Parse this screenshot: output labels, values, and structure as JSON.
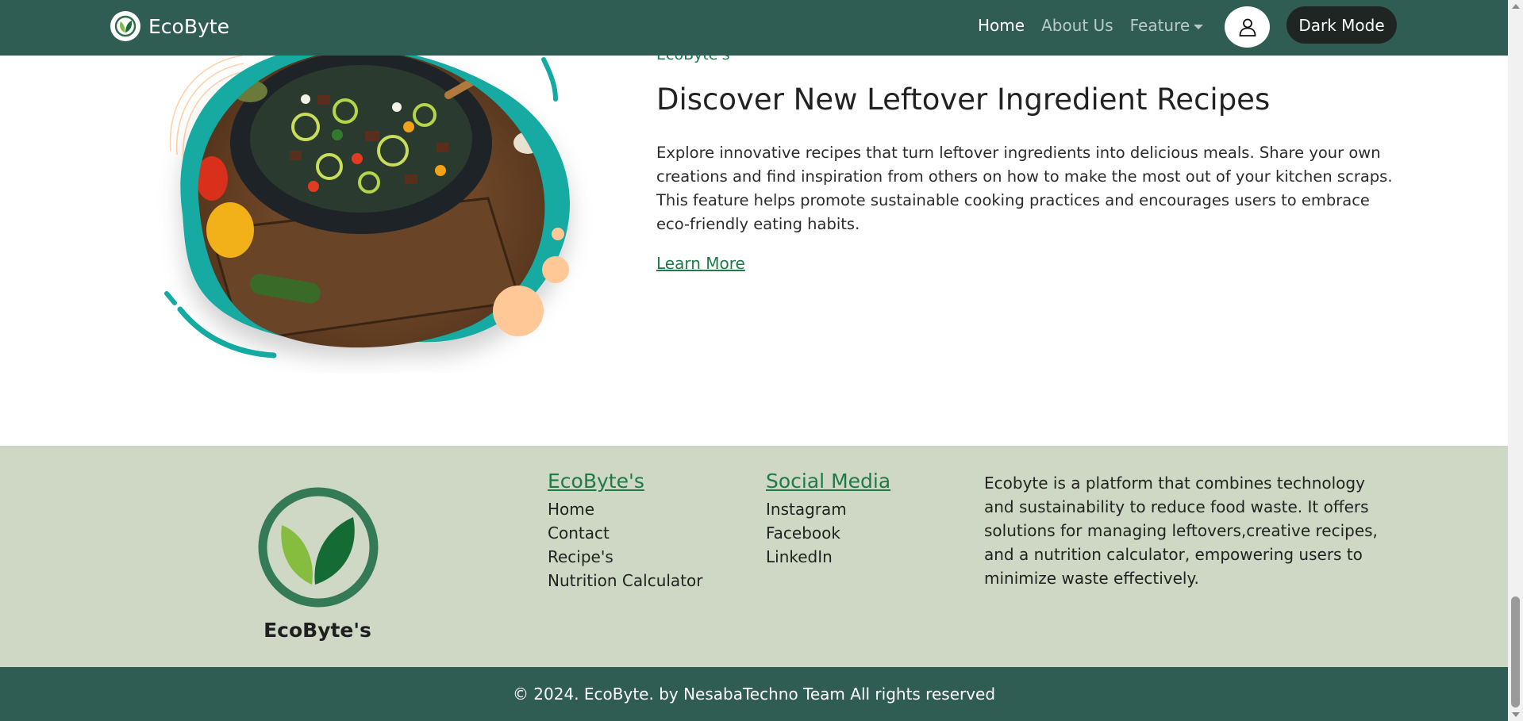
{
  "navbar": {
    "brand_name": "EcoByte",
    "links": [
      {
        "label": "Home",
        "active": true
      },
      {
        "label": "About Us",
        "active": false
      },
      {
        "label": "Feature",
        "active": false
      }
    ],
    "dark_mode_label": "Dark Mode",
    "icons": [
      "leaf-logo-icon",
      "user-icon",
      "caret-down-icon"
    ]
  },
  "feature": {
    "eyebrow": "EcoByte's",
    "title": "Discover New Leftover Ingredient Recipes",
    "description": "Explore innovative recipes that turn leftover ingredients into delicious meals. Share your own creations and find inspiration from others on how to make the most out of your kitchen scraps. This feature helps promote sustainable cooking practices and encourages users to embrace eco-friendly eating habits.",
    "learn_more": "Learn More"
  },
  "footer": {
    "brand": "EcoByte's",
    "columns": [
      {
        "heading": "EcoByte's",
        "items": [
          "Home",
          "Contact",
          "Recipe's",
          "Nutrition Calculator"
        ]
      },
      {
        "heading": "Social Media",
        "items": [
          "Instagram",
          "Facebook",
          "LinkedIn"
        ]
      }
    ],
    "about": "Ecobyte is a platform that combines technology and sustainability to reduce food waste. It offers solutions for managing leftovers,creative recipes, and a nutrition calculator, empowering users to minimize waste effectively.",
    "copyright": "© 2024. EcoByte. by NesabaTechno Team All rights reserved"
  },
  "colors": {
    "header_bg": "#2f5d54",
    "footer_bg": "#ced8c4",
    "accent_green": "#1f7a4a",
    "teal_blob": "#13aaa2",
    "peach": "#ffc896"
  }
}
